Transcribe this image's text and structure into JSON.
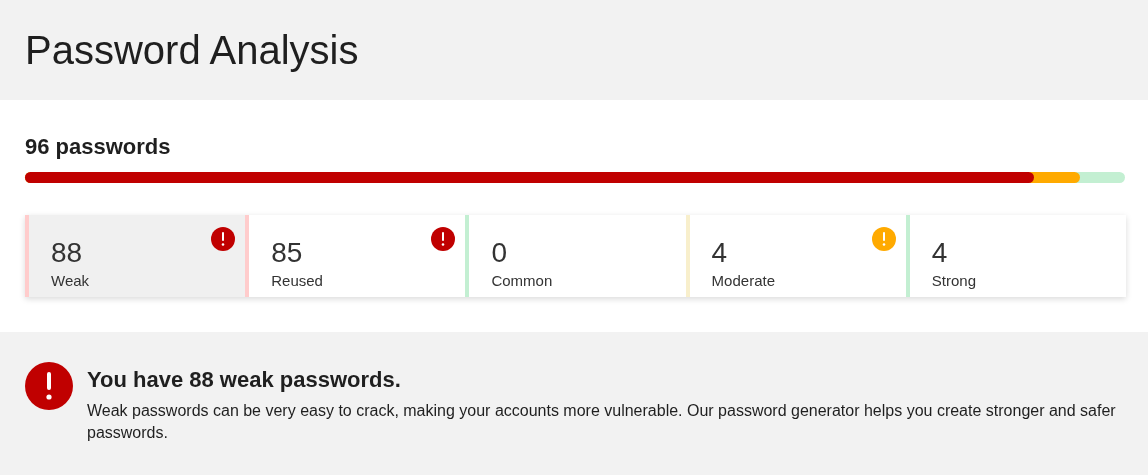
{
  "title": "Password Analysis",
  "summary": {
    "count_label": "96 passwords",
    "segments": [
      {
        "color": "#c00000",
        "level": 0.917
      },
      {
        "color": "#ffaa00",
        "level": 0.959
      }
    ]
  },
  "cards": [
    {
      "count": "88",
      "label": "Weak",
      "color": "#ffcccc",
      "selected": true,
      "alert": {
        "color": "#c00000"
      }
    },
    {
      "count": "85",
      "label": "Reused",
      "color": "#ffcccc",
      "selected": false,
      "alert": {
        "color": "#c00000"
      }
    },
    {
      "count": "0",
      "label": "Common",
      "color": "#c3efd2",
      "selected": false
    },
    {
      "count": "4",
      "label": "Moderate",
      "color": "#f8efcc",
      "selected": false,
      "alert": {
        "color": "#ffaa00"
      }
    },
    {
      "count": "4",
      "label": "Strong",
      "color": "#c3efd2",
      "selected": false
    }
  ],
  "message": {
    "heading": "You have 88 weak passwords.",
    "body": "Weak passwords can be very easy to crack, making your accounts more vulnerable. Our password generator helps you create stronger and safer passwords."
  }
}
